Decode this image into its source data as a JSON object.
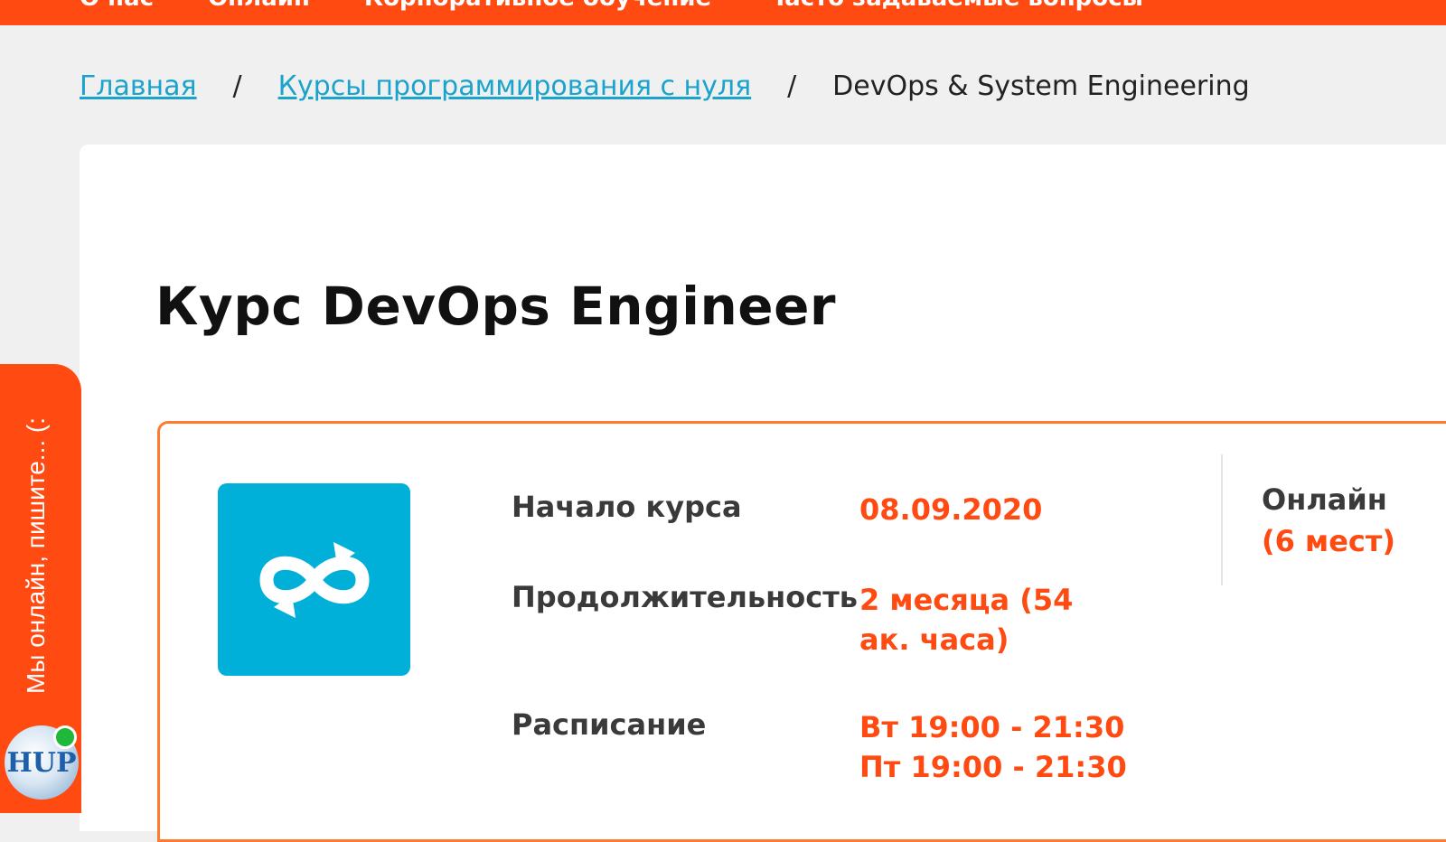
{
  "topnav": {
    "items": [
      "О нас",
      "Онлайн",
      "Корпоративное обучение",
      "Часто задаваемые вопросы"
    ]
  },
  "breadcrumb": {
    "home": "Главная",
    "sep1": "/",
    "section": "Курсы программирования с нуля",
    "sep2": "/",
    "current": "DevOps & System Engineering"
  },
  "course": {
    "title": "Курс DevOps Engineer",
    "icon": "sync-loop-icon",
    "start_label": "Начало курса",
    "start_value": "08.09.2020",
    "duration_label": "Продолжительность",
    "duration_value": "2 месяца (54 ак. часа)",
    "schedule_label": "Расписание",
    "schedule_line1": "Вт 19:00 - 21:30",
    "schedule_line2": "Пт 19:00 - 21:30",
    "format": "Онлайн",
    "seats": "(6 мест)"
  },
  "chat": {
    "label": "Мы онлайн, пишите... (:",
    "avatar_text": "HUP"
  },
  "colors": {
    "accent": "#ff4a12",
    "icon_bg": "#00b0d8",
    "link": "#1aa3cc"
  }
}
